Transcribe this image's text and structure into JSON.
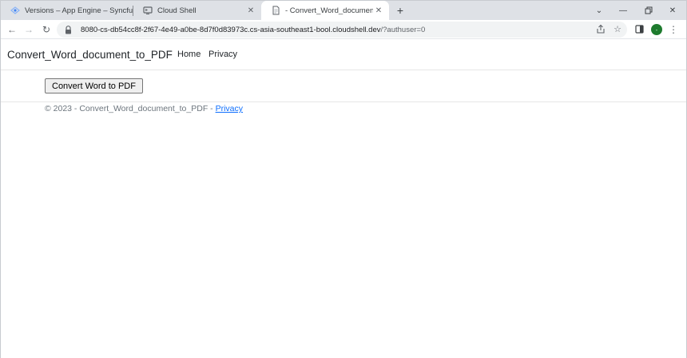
{
  "browser": {
    "tabs": [
      {
        "title": "Versions – App Engine – Syncfusi",
        "active": false,
        "icon": "app-engine-icon"
      },
      {
        "title": "Cloud Shell",
        "active": false,
        "icon": "cloud-shell-icon"
      },
      {
        "title": "- Convert_Word_document_to_PDF",
        "active": true,
        "icon": "page-icon"
      }
    ],
    "new_tab_symbol": "+",
    "url_host": "8080-cs-db54cc8f-2f67-4e49-a0be-8d7f0d83973c.cs-asia-southeast1-bool.cloudshell.dev",
    "url_path": "/?authuser=0",
    "profile_initial": "-",
    "window_controls": [
      "chevron-down-icon",
      "minimize-icon",
      "restore-icon",
      "close-icon"
    ],
    "accent_color": "#1e7b2e"
  },
  "page": {
    "brand": "Convert_Word_document_to_PDF",
    "nav": [
      {
        "label": "Home"
      },
      {
        "label": "Privacy"
      }
    ],
    "button_label": "Convert Word to PDF",
    "footer": {
      "text": "© 2023 - Convert_Word_document_to_PDF - ",
      "link": "Privacy"
    }
  }
}
